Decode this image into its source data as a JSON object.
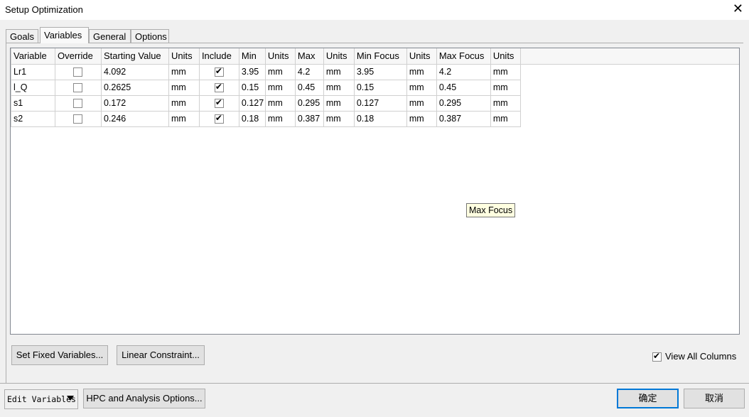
{
  "window": {
    "title": "Setup Optimization",
    "close_glyph": "✕"
  },
  "tabs": [
    {
      "label": "Goals"
    },
    {
      "label": "Variables"
    },
    {
      "label": "General"
    },
    {
      "label": "Options"
    }
  ],
  "grid": {
    "headers": [
      "Variable",
      "Override",
      "Starting Value",
      "Units",
      "Include",
      "Min",
      "Units",
      "Max",
      "Units",
      "Min Focus",
      "Units",
      "Max Focus",
      "Units"
    ],
    "rows": [
      {
        "variable": "Lr1",
        "override": false,
        "start": "4.092",
        "start_units": "mm",
        "include": true,
        "min": "3.95",
        "min_units": "mm",
        "max": "4.2",
        "max_units": "mm",
        "min_focus": "3.95",
        "min_focus_units": "mm",
        "max_focus": "4.2",
        "max_focus_units": "mm"
      },
      {
        "variable": "l_Q",
        "override": false,
        "start": "0.2625",
        "start_units": "mm",
        "include": true,
        "min": "0.15",
        "min_units": "mm",
        "max": "0.45",
        "max_units": "mm",
        "min_focus": "0.15",
        "min_focus_units": "mm",
        "max_focus": "0.45",
        "max_focus_units": "mm"
      },
      {
        "variable": "s1",
        "override": false,
        "start": "0.172",
        "start_units": "mm",
        "include": true,
        "min": "0.127",
        "min_units": "mm",
        "max": "0.295",
        "max_units": "mm",
        "min_focus": "0.127",
        "min_focus_units": "mm",
        "max_focus": "0.295",
        "max_focus_units": "mm"
      },
      {
        "variable": "s2",
        "override": false,
        "start": "0.246",
        "start_units": "mm",
        "include": true,
        "min": "0.18",
        "min_units": "mm",
        "max": "0.387",
        "max_units": "mm",
        "min_focus": "0.18",
        "min_focus_units": "mm",
        "max_focus": "0.387",
        "max_focus_units": "mm"
      }
    ]
  },
  "tooltip": {
    "text": "Max Focus"
  },
  "buttons": {
    "set_fixed": "Set Fixed Variables...",
    "linear_constraint": "Linear Constraint...",
    "view_all_columns": "View All Columns",
    "view_all_checked": true,
    "edit_variables": "Edit Variables",
    "hpc_options": "HPC and Analysis Options...",
    "ok": "确定",
    "cancel": "取消"
  },
  "colors": {
    "default_button_border": "#0078d7",
    "tooltip_bg": "#ffffe1"
  }
}
